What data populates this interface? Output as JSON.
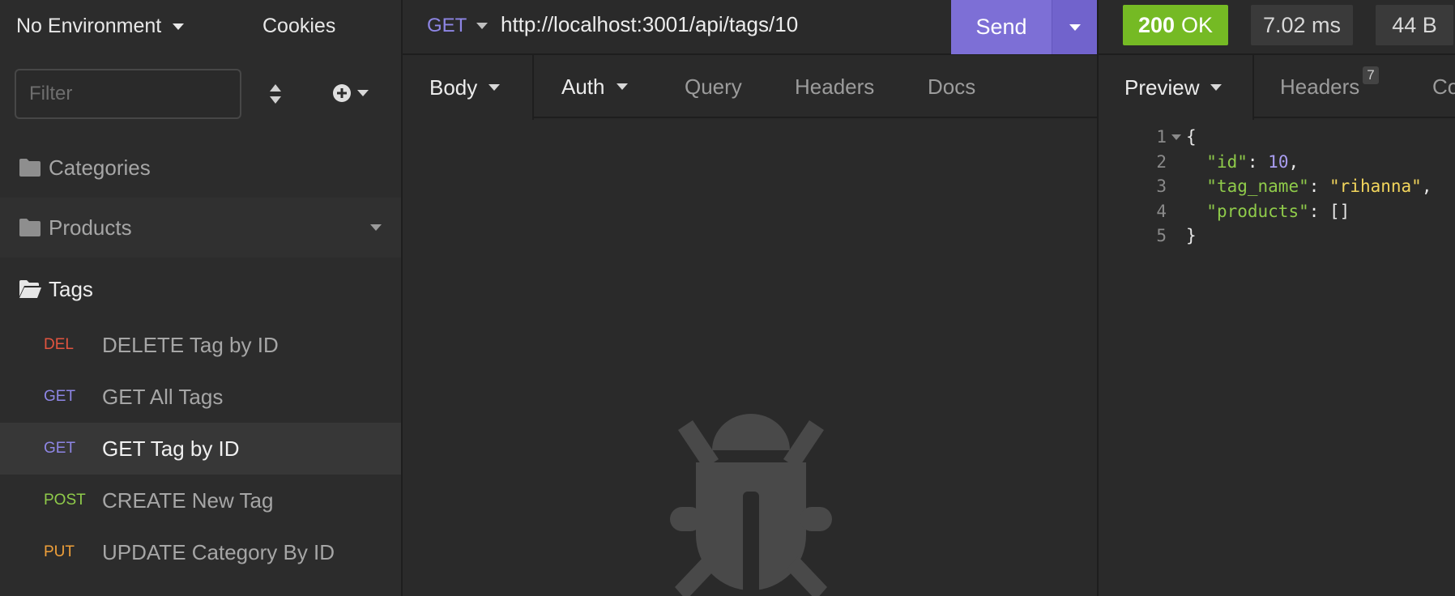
{
  "sidebar": {
    "environment": "No Environment",
    "cookies": "Cookies",
    "filter_placeholder": "Filter",
    "folders": [
      {
        "label": "Categories"
      },
      {
        "label": "Products"
      },
      {
        "label": "Tags"
      }
    ],
    "requests": [
      {
        "method": "DEL",
        "name": "DELETE Tag by ID",
        "color": "#e2543f"
      },
      {
        "method": "GET",
        "name": "GET All Tags",
        "color": "#8e86e5"
      },
      {
        "method": "GET",
        "name": "GET Tag by ID",
        "color": "#8e86e5"
      },
      {
        "method": "POST",
        "name": "CREATE New Tag",
        "color": "#8fcb4a"
      },
      {
        "method": "PUT",
        "name": "UPDATE Category By ID",
        "color": "#f0a03a"
      }
    ]
  },
  "request": {
    "method": "GET",
    "url": "http://localhost:3001/api/tags/10",
    "send_label": "Send",
    "tabs": [
      "Body",
      "Auth",
      "Query",
      "Headers",
      "Docs"
    ]
  },
  "response": {
    "status_code": "200",
    "status_text": "OK",
    "time": "7.02 ms",
    "size": "44 B",
    "tabs": [
      "Preview",
      "Headers",
      "Co"
    ],
    "headers_count": "7",
    "line_numbers": [
      "1",
      "2",
      "3",
      "4",
      "5"
    ],
    "json": {
      "open": "{",
      "id_key": "\"id\"",
      "id_value": "10",
      "tag_name_key": "\"tag_name\"",
      "tag_name_value": "\"rihanna\"",
      "products_key": "\"products\"",
      "products_value": "[]",
      "close": "}"
    }
  },
  "colors": {
    "accent": "#7d6fd6",
    "success": "#75ba24"
  }
}
